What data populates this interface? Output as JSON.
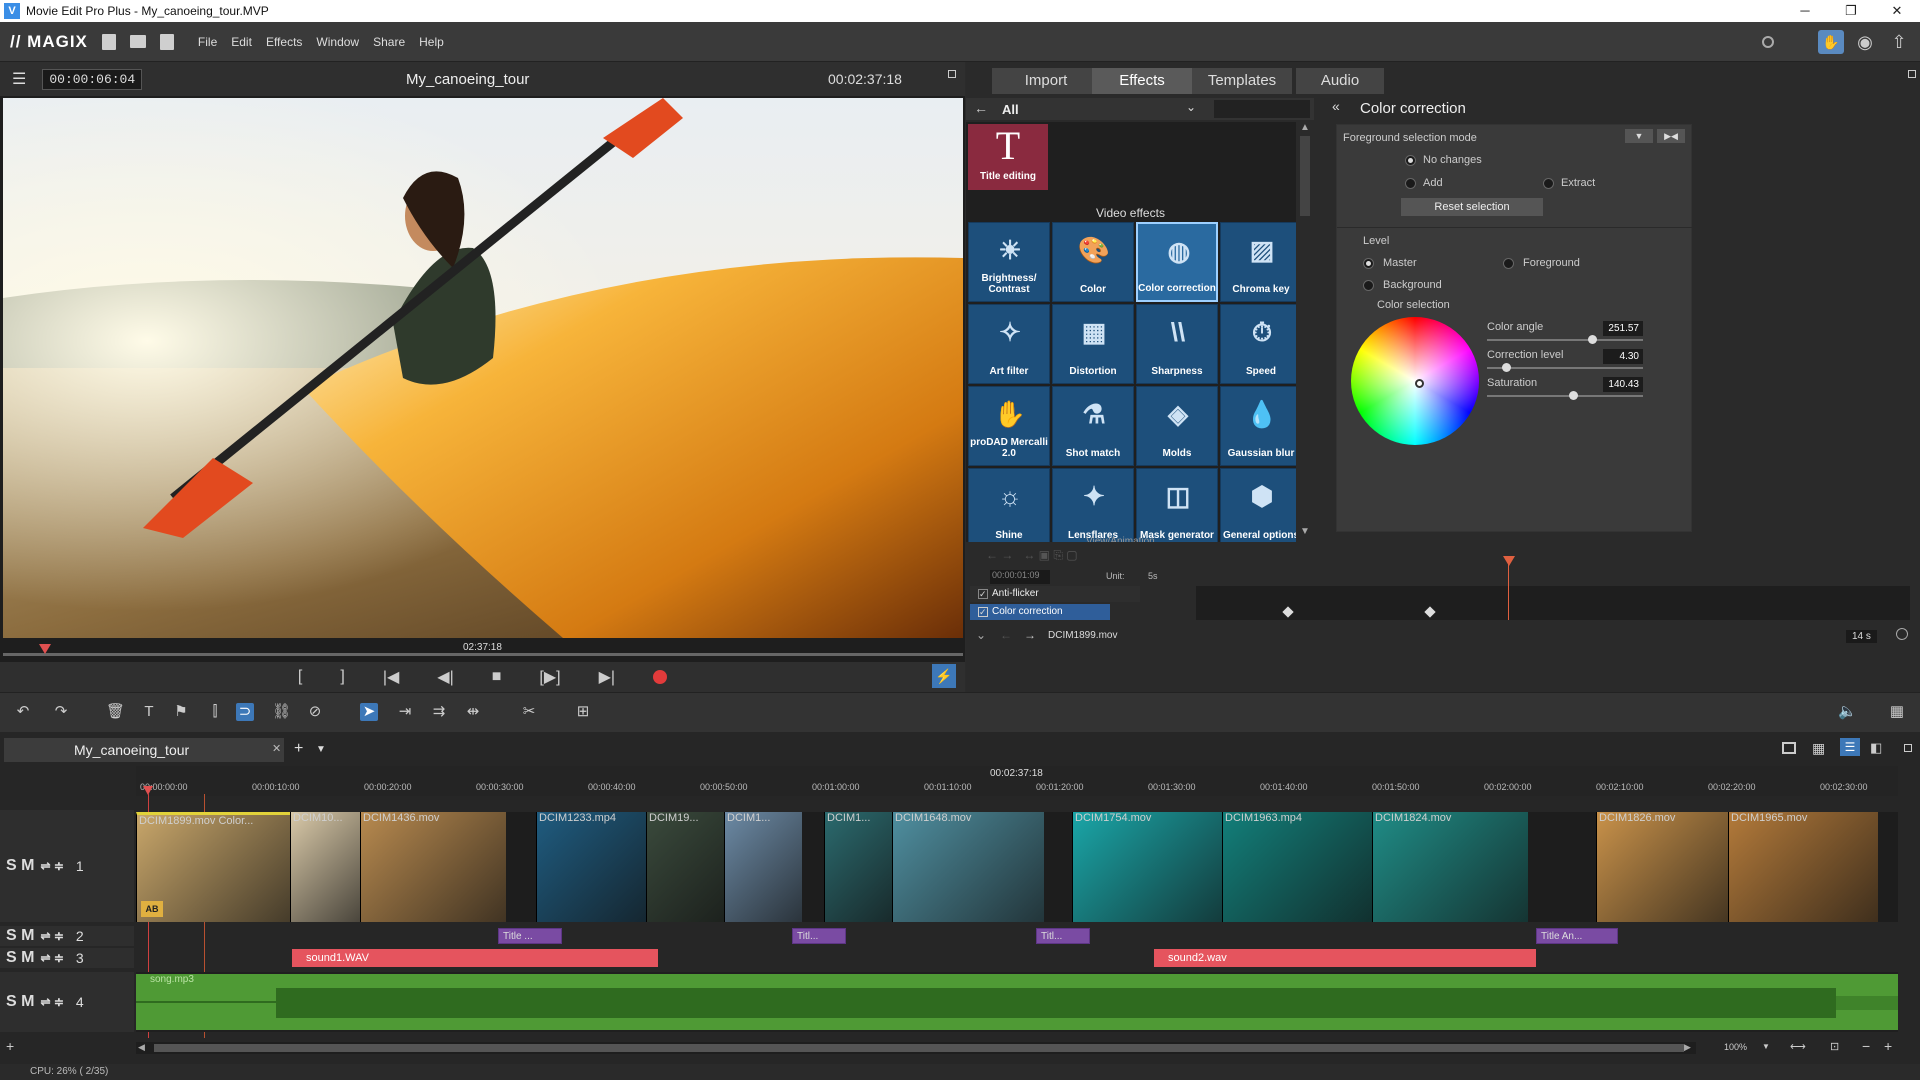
{
  "titlebar": {
    "title": "Movie Edit Pro Plus - My_canoeing_tour.MVP",
    "app_icon": "V",
    "minimize": "─",
    "restore": "❐",
    "close": "✕"
  },
  "menubar": {
    "logo": "// MAGIX",
    "items": [
      "File",
      "Edit",
      "Effects",
      "Window",
      "Share",
      "Help"
    ]
  },
  "preview": {
    "menu_icon": "☰",
    "current_time": "00:00:06:04",
    "project_title": "My_canoeing_tour",
    "duration": "00:02:37:18",
    "scrub_time": "02:37:18",
    "transport": [
      "[",
      "]",
      "|◀",
      "◀|",
      "■",
      "[▶]",
      "▶|"
    ]
  },
  "mediapool": {
    "tabs": [
      "Import",
      "Effects",
      "Templates",
      "Audio"
    ],
    "active_tab": "Effects",
    "filter": "All",
    "section_video_effects": "Video effects",
    "title_editing": "Title editing",
    "title_editing_glyph": "T",
    "effects": [
      "Brightness/ Contrast",
      "Color",
      "Color correction",
      "Chroma key",
      "Art filter",
      "Distortion",
      "Sharpness",
      "Speed",
      "proDAD Mercalli 2.0",
      "Shot match",
      "Molds",
      "Gaussian blur",
      "Shine",
      "Lensflares",
      "Mask generator",
      "General options"
    ],
    "selected_effect": "Color correction",
    "view_animation": "View/Animation"
  },
  "color_correction": {
    "title": "Color correction",
    "fg_mode_label": "Foreground selection mode",
    "no_changes": "No changes",
    "add": "Add",
    "extract": "Extract",
    "reset": "Reset selection",
    "level_label": "Level",
    "master": "Master",
    "foreground": "Foreground",
    "background": "Background",
    "color_selection": "Color selection",
    "color_angle_label": "Color angle",
    "color_angle": "251.57",
    "color_angle_fraction": 0.67,
    "correction_level_label": "Correction level",
    "correction_level": "4.30",
    "correction_level_fraction": 0.12,
    "saturation_label": "Saturation",
    "saturation": "140.43",
    "saturation_fraction": 0.55
  },
  "keyframes": {
    "time": "00:00:01:09",
    "unit_label": "Unit:",
    "unit": "5s",
    "tracks": [
      "Anti-flicker",
      "Color correction"
    ],
    "file": "DCIM1899.mov",
    "zoom": "14 s"
  },
  "timeline": {
    "tab_title": "My_canoeing_tour",
    "add_tab": "+",
    "total_time": "00:02:37:18",
    "ruler": [
      "00:00:00:00",
      "00:00:10:00",
      "00:00:20:00",
      "00:00:30:00",
      "00:00:40:00",
      "00:00:50:00",
      "00:01:00:00",
      "00:01:10:00",
      "00:01:20:00",
      "00:01:30:00",
      "00:01:40:00",
      "00:01:50:00",
      "00:02:00:00",
      "00:02:10:00",
      "00:02:20:00",
      "00:02:30:00"
    ],
    "track_controls": "S M",
    "track_numbers": [
      "1",
      "2",
      "3",
      "4"
    ],
    "video_clips": [
      {
        "label": "DCIM1899.mov  Color...",
        "color": "#c8a66a"
      },
      {
        "label": "DCIM10...",
        "color": "#d9c9a8"
      },
      {
        "label": "DCIM1436.mov",
        "color": "#b88a4f"
      },
      {
        "label": "DCIM1233.mp4",
        "color": "#1f5c80"
      },
      {
        "label": "DCIM19...",
        "color": "#3a4a3c"
      },
      {
        "label": "DCIM1...",
        "color": "#6c8aa5"
      },
      {
        "label": "DCIM1...",
        "color": "#2b6a6e"
      },
      {
        "label": "DCIM1648.mov",
        "color": "#4f8fa0"
      },
      {
        "label": "DCIM1754.mov",
        "color": "#1aa6a8"
      },
      {
        "label": "DCIM1963.mp4",
        "color": "#127f7a"
      },
      {
        "label": "DCIM1824.mov",
        "color": "#1f8c86"
      },
      {
        "label": "DCIM1826.mov",
        "color": "#c9924a"
      },
      {
        "label": "DCIM1965.mov",
        "color": "#b37a3a"
      }
    ],
    "title_clips": [
      "Title ...",
      "Titl...",
      "Titl...",
      "Title   An..."
    ],
    "audio_clips": [
      "sound1.WAV",
      "sound2.wav"
    ],
    "song": "song.mp3",
    "zoom": "100%"
  },
  "status": {
    "cpu": "CPU: 26% ( 2/35)"
  },
  "colors": {
    "accent_blue": "#1d4f7b",
    "title_purple": "#7a4ba3",
    "audio_red": "#e5545e",
    "audio_green": "#5fae3d",
    "record_red": "#e23b3b"
  }
}
